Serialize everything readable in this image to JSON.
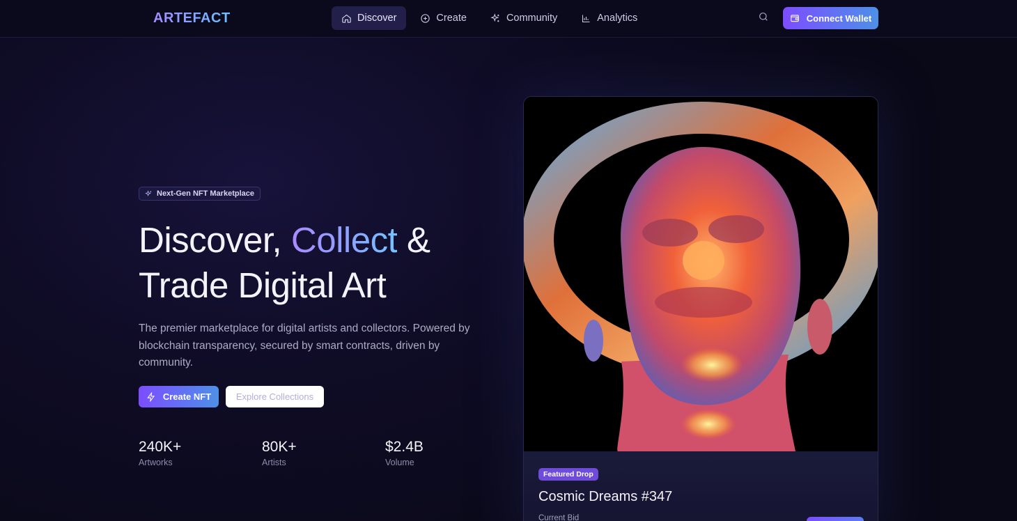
{
  "nav": {
    "logo": "ARTEFACT",
    "items": [
      {
        "label": "Discover",
        "icon": "home-icon",
        "active": true
      },
      {
        "label": "Create",
        "icon": "plus-circle-icon",
        "active": false
      },
      {
        "label": "Community",
        "icon": "sparkles-icon",
        "active": false
      },
      {
        "label": "Analytics",
        "icon": "bar-chart-icon",
        "active": false
      }
    ],
    "search_icon": "search-icon",
    "wallet_label": "Connect Wallet"
  },
  "hero": {
    "badge": "Next-Gen NFT Marketplace",
    "headline_part1": "Discover, ",
    "headline_accent": "Collect",
    "headline_part2": " & Trade Digital Art",
    "description": "The premier marketplace for digital artists and collectors. Powered by blockchain transparency, secured by smart contracts, driven by community.",
    "primary_cta": "Create NFT",
    "secondary_cta": "Explore Collections",
    "stats": [
      {
        "value": "240K+",
        "label": "Artworks"
      },
      {
        "value": "80K+",
        "label": "Artists"
      },
      {
        "value": "$2.4B",
        "label": "Volume"
      }
    ]
  },
  "featured": {
    "tag": "Featured Drop",
    "title": "Cosmic Dreams #347",
    "bid_label": "Current Bid"
  },
  "colors": {
    "accent_purple": "#7c4dff",
    "accent_blue": "#4e90e6",
    "background": "#0f0c26"
  }
}
